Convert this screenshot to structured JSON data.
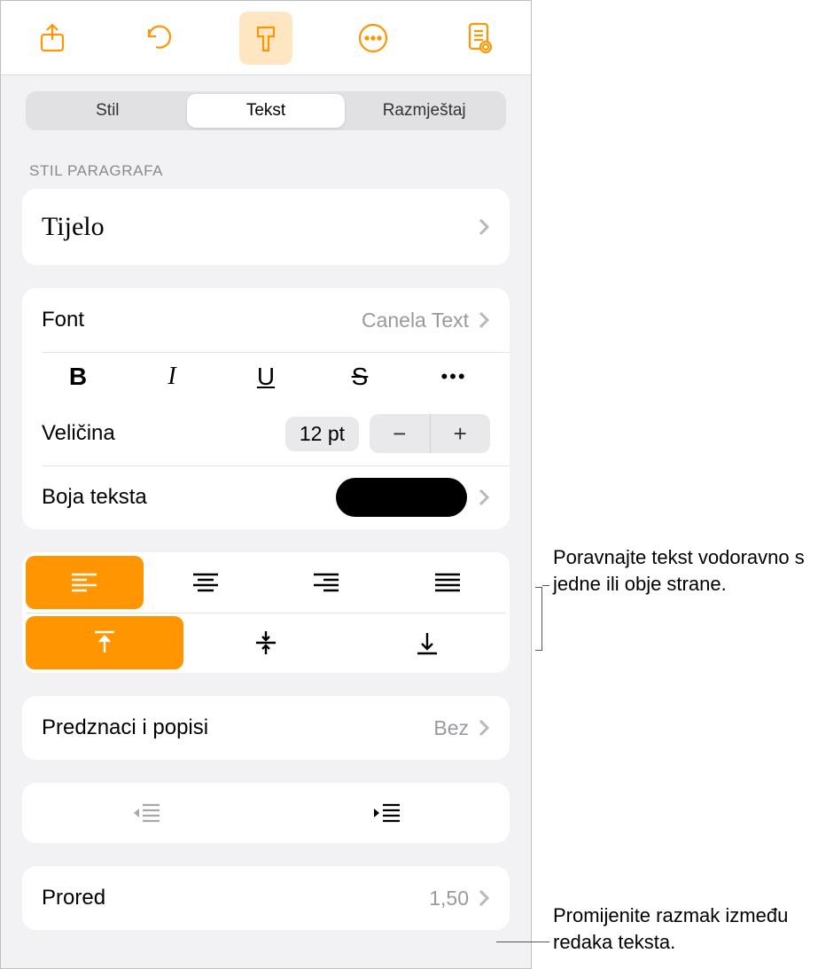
{
  "tabs": {
    "stil": "Stil",
    "tekst": "Tekst",
    "razmjestaj": "Razmještaj"
  },
  "section_paragraph_style": "STIL PARAGRAFA",
  "paragraph_style_value": "Tijelo",
  "font": {
    "label": "Font",
    "value": "Canela Text"
  },
  "style_buttons": {
    "bold": "B",
    "italic": "I",
    "underline": "U",
    "strike": "S",
    "more": "•••"
  },
  "size": {
    "label": "Veličina",
    "value": "12 pt",
    "minus": "−",
    "plus": "+"
  },
  "text_color": {
    "label": "Boja teksta",
    "value_hex": "#000000"
  },
  "bullets": {
    "label": "Predznaci i popisi",
    "value": "Bez"
  },
  "line_spacing": {
    "label": "Prored",
    "value": "1,50"
  },
  "callouts": {
    "align": "Poravnajte tekst vodoravno s jedne ili obje strane.",
    "spacing": "Promijenite razmak između redaka teksta."
  }
}
